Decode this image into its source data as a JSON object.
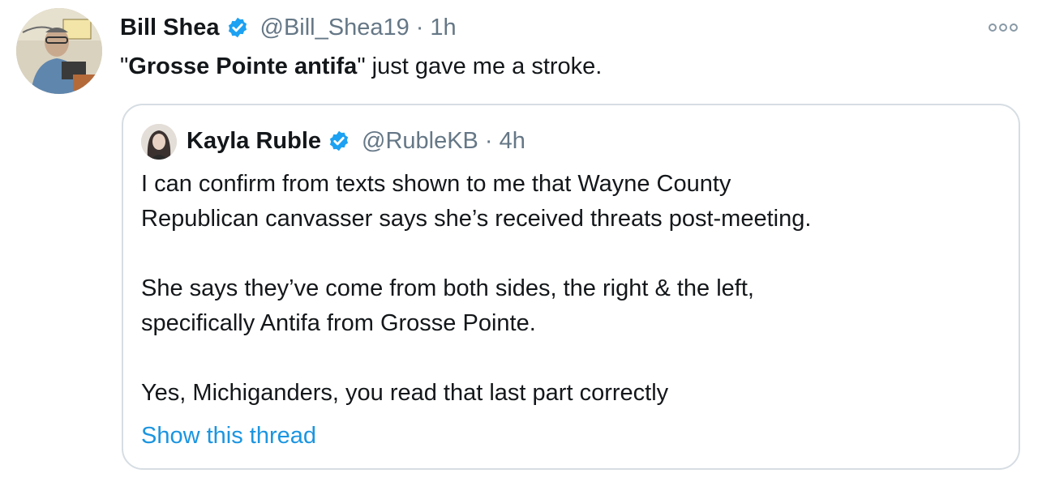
{
  "tweet": {
    "author": {
      "display_name": "Bill Shea",
      "handle": "@Bill_Shea19",
      "time": "1h",
      "verified": true
    },
    "separator": "·",
    "text_bold": "Grosse Pointe antifa",
    "text_open_quote": "\"",
    "text_close_quote": "\"",
    "text_rest": " just gave me a stroke.",
    "more_icon": "more-dots-icon"
  },
  "quoted_tweet": {
    "author": {
      "display_name": "Kayla Ruble",
      "handle": "@RubleKB",
      "time": "4h",
      "verified": true
    },
    "separator": "·",
    "paragraphs": [
      [
        "I can confirm from texts shown to me that Wayne County",
        "Republican canvasser says she’s received threats post-meeting."
      ],
      [
        "She says they’ve come from both sides, the right & the left,",
        "specifically Antifa from Grosse Pointe."
      ],
      [
        "Yes, Michiganders, you read that last part correctly"
      ]
    ],
    "show_thread_label": "Show this thread"
  },
  "colors": {
    "text": "#14171a",
    "secondary": "#657786",
    "link": "#1b95e0",
    "verified": "#1da1f2",
    "border": "#d6dde3"
  }
}
